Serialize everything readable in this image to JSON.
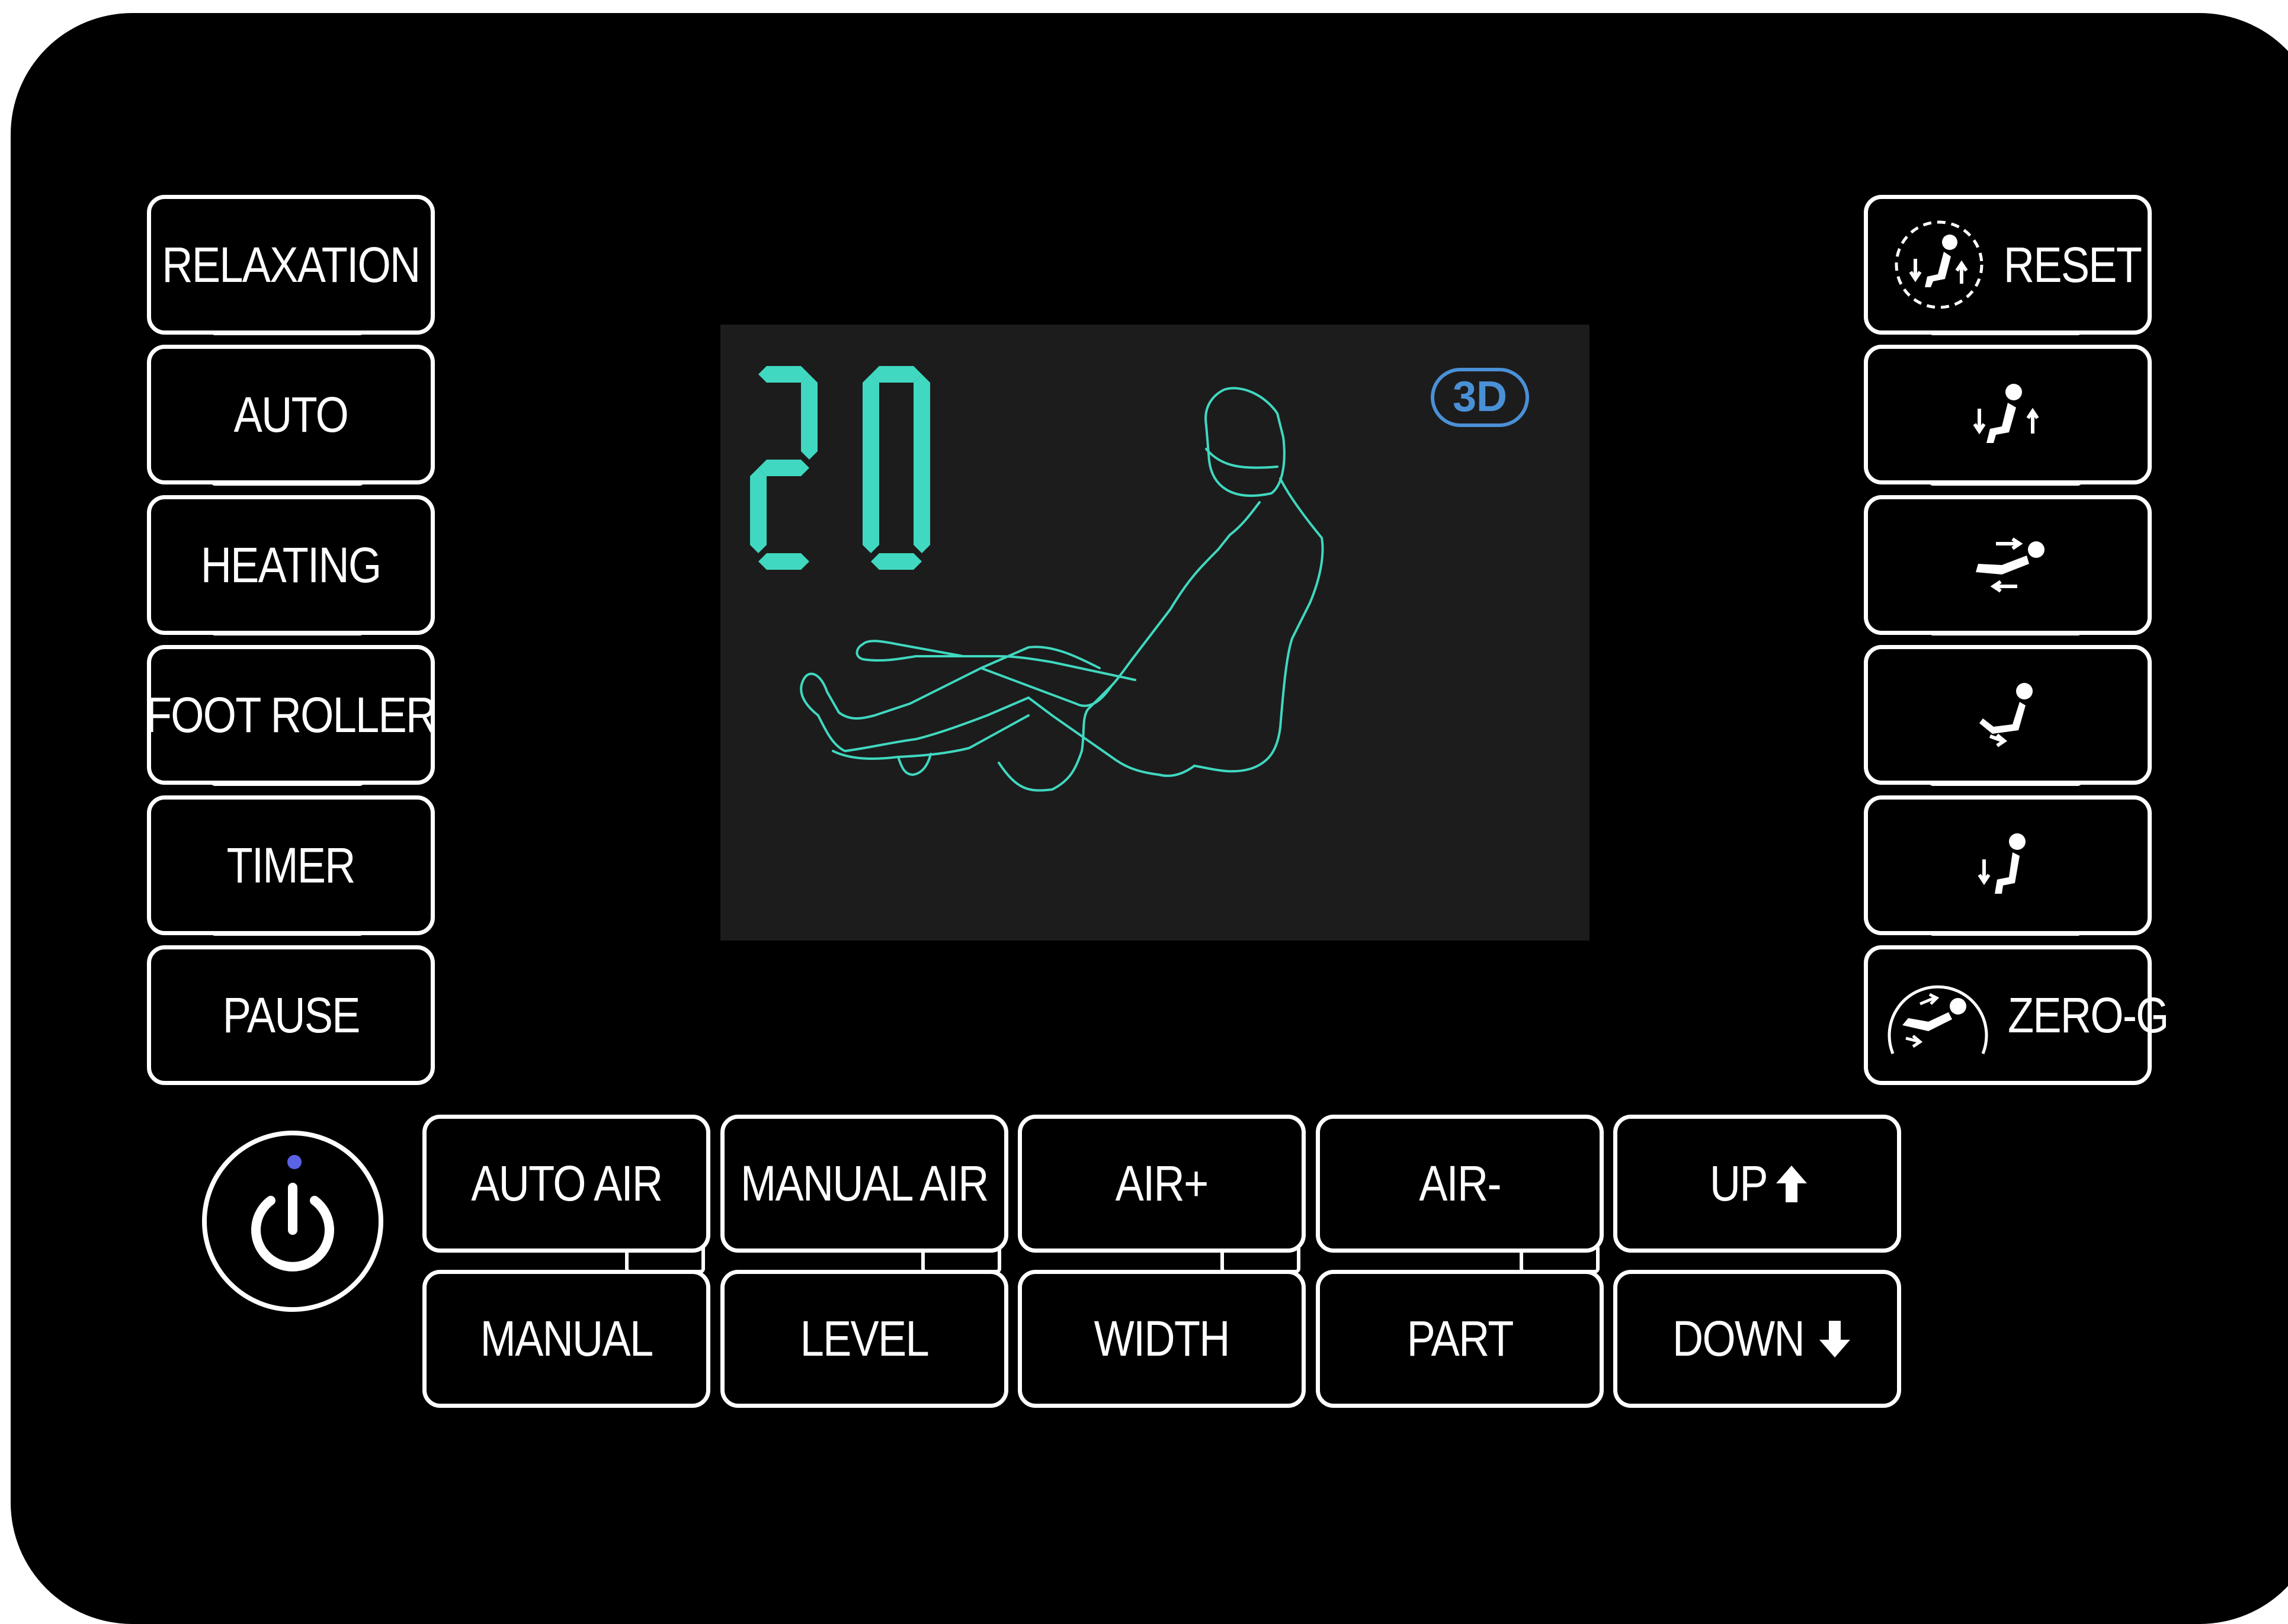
{
  "left_modes": [
    "RELAXATION",
    "AUTO",
    "HEATING",
    "FOOT ROLLER",
    "TIMER",
    "PAUSE"
  ],
  "right_modes": {
    "reset": "RESET",
    "zero_g": "ZERO-G"
  },
  "bottom_row1": [
    "AUTO AIR",
    "MANUAL AIR",
    "AIR+",
    "AIR-",
    "UP"
  ],
  "bottom_row2": [
    "MANUAL",
    "LEVEL",
    "WIDTH",
    "PART",
    "DOWN"
  ],
  "display": {
    "timer_value": "20",
    "badge": "3D",
    "digit_color": "#40d8c0",
    "outline_color": "#40d8c0",
    "badge_color": "#4a90d6"
  },
  "colors": {
    "panel": "#000000",
    "led": "#5a62e6"
  }
}
